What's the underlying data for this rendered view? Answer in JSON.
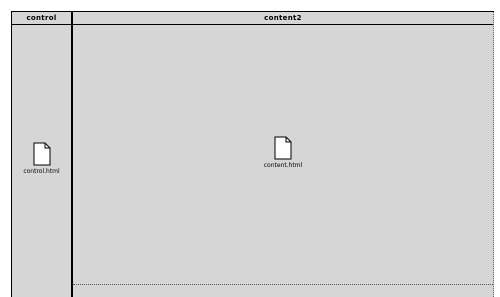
{
  "frames": {
    "control": {
      "header": "control",
      "file_label": "control.html",
      "icon": "document-icon"
    },
    "content": {
      "header": "content2",
      "file_label": "content.html",
      "icon": "document-icon"
    }
  }
}
